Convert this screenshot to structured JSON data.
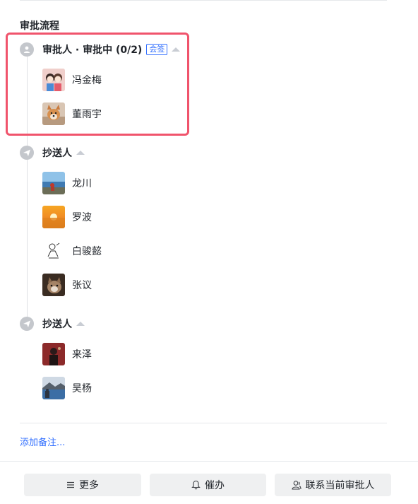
{
  "section_title": "审批流程",
  "approval_node": {
    "label": "审批人 · 审批中 (0/2)",
    "tag": "会签",
    "icon": "person-icon",
    "people": [
      {
        "name": "冯金梅",
        "avatar": "avatar-cartoon-couple"
      },
      {
        "name": "董雨宇",
        "avatar": "avatar-dog"
      }
    ]
  },
  "cc_nodes": [
    {
      "label": "抄送人",
      "icon": "send-icon",
      "people": [
        {
          "name": "龙川",
          "avatar": "avatar-seaside"
        },
        {
          "name": "罗波",
          "avatar": "avatar-sunset"
        },
        {
          "name": "白骏懿",
          "avatar": "avatar-sketch"
        },
        {
          "name": "张议",
          "avatar": "avatar-cat"
        }
      ]
    },
    {
      "label": "抄送人",
      "icon": "send-icon",
      "people": [
        {
          "name": "来泽",
          "avatar": "avatar-dark-portrait"
        },
        {
          "name": "吴杨",
          "avatar": "avatar-lake"
        }
      ]
    }
  ],
  "add_note": "添加备注...",
  "footer": {
    "more": "更多",
    "remind": "催办",
    "contact": "联系当前审批人"
  },
  "colors": {
    "accent": "#3370ff",
    "highlight": "#f0546c",
    "node_icon": "#c4c7cc"
  }
}
